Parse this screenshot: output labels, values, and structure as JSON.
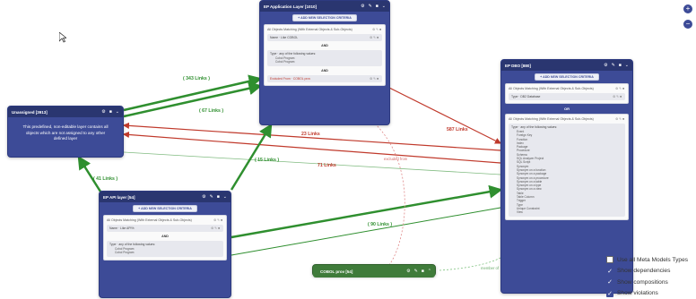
{
  "header_buttons": {
    "zoom_in": "+",
    "zoom_out": "−"
  },
  "icons": [
    "gear-icon",
    "edit-icon",
    "trash-icon",
    "chevron-down-icon",
    "chevron-up-icon"
  ],
  "colors": {
    "node_blue": "#3d4b97",
    "node_green": "#3f7b3a",
    "link_green": "#2f8f2f",
    "link_red": "#c0392b"
  },
  "nodes": {
    "application_layer": {
      "title": "EP Application Layer [1010]",
      "add_button": "+ ADD NEW SELECTION CRITERIA",
      "panel_title": "All Objects Matching (With External Objects & Sub-Objects)",
      "crit1": "Name · Like COBOL",
      "op1": "AND",
      "crit2_header": "Type · any of the following values:",
      "crit2_values": [
        "Cobol Program",
        "Cobol Program"
      ],
      "op2": "AND",
      "crit3": "Excluded From · COBOL prov"
    },
    "unassigned": {
      "title": "Unassigned [3913]",
      "description": "This predefined, non-editable layer contains all objects which are not assigned to any other defined layer"
    },
    "api_layer": {
      "title": "EP API layer [54]",
      "add_button": "+ ADD NEW SELECTION CRITERIA",
      "panel_title": "All Objects Matching (With External Objects & Sub-Objects)",
      "crit1": "Name · Like API%",
      "op1": "AND",
      "crit2_header": "Type · any of the following values:",
      "crit2_values": [
        "Cobol Program",
        "Cobol Program"
      ]
    },
    "dbo_layer": {
      "title": "EP DBO [880]",
      "add_button": "+ ADD NEW SELECTION CRITERIA",
      "panel_title": "All Objects Matching (With External Objects & Sub-Objects)",
      "crit1": "Type · DB2 Database",
      "op1": "OR",
      "panel2_title": "All Objects Matching (With External Objects & Sub-Objects)",
      "crit2_header": "Type · any of the following values:",
      "crit2_values": [
        "Event",
        "Foreign Key",
        "Function",
        "Index",
        "Package",
        "Procedure",
        "Schema",
        "SQL Analyzer Project",
        "SQL Script",
        "Synonym",
        "Synonym on a function",
        "Synonym on a package",
        "Synonym on a procedure",
        "Synonym on a table",
        "Synonym on a type",
        "Synonym on a view",
        "Table",
        "Table Column",
        "Trigger",
        "Type",
        "Unique Constraint",
        "View"
      ]
    },
    "cobol_prov": {
      "title": "COBOL prov [54]"
    }
  },
  "links": [
    {
      "label": "( 343 Links )",
      "kind": "green"
    },
    {
      "label": "( 67 Links )",
      "kind": "green"
    },
    {
      "label": "23 Links",
      "kind": "red"
    },
    {
      "label": "587 Links",
      "kind": "red"
    },
    {
      "label": "( 15 Links )",
      "kind": "green"
    },
    {
      "label": "71 Links",
      "kind": "red"
    },
    {
      "label": "( 41 Links )",
      "kind": "green"
    },
    {
      "label": "( 90 Links )",
      "kind": "green"
    },
    {
      "label": "excluded from",
      "kind": "note"
    },
    {
      "label": "member of",
      "kind": "note"
    }
  ],
  "legend": [
    {
      "label": "Use all Meta Models Types",
      "checked": false
    },
    {
      "label": "Show dependencies",
      "checked": true
    },
    {
      "label": "Show compositions",
      "checked": true
    },
    {
      "label": "Show violations",
      "checked": true
    }
  ]
}
